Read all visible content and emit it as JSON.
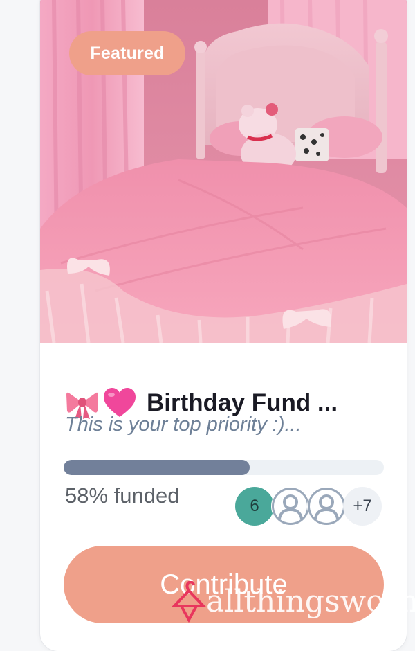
{
  "card": {
    "badge": "Featured",
    "photo_alt": "photo",
    "title_emojis": [
      "ribbon-emoji",
      "pink-heart-emoji"
    ],
    "title": "Birthday Fund ...",
    "subtitle": "This is your top priority :)...",
    "progress": {
      "fraction": 0.58
    },
    "funded_label": "58% funded",
    "contributors": {
      "count_badge": "6",
      "avatars": [
        "user-avatar",
        "user-avatar"
      ],
      "more": "+7"
    },
    "contribute_label": "Contribute"
  },
  "watermark": {
    "text": "allthingsworn",
    "icon": "hanger-icon"
  },
  "colors": {
    "accent": "#efa08a",
    "progress_fill": "#72809a",
    "progress_track": "#edf1f5",
    "title": "#1a1a24",
    "subtitle": "#6e8097",
    "count_badge": "#4aa89a"
  }
}
